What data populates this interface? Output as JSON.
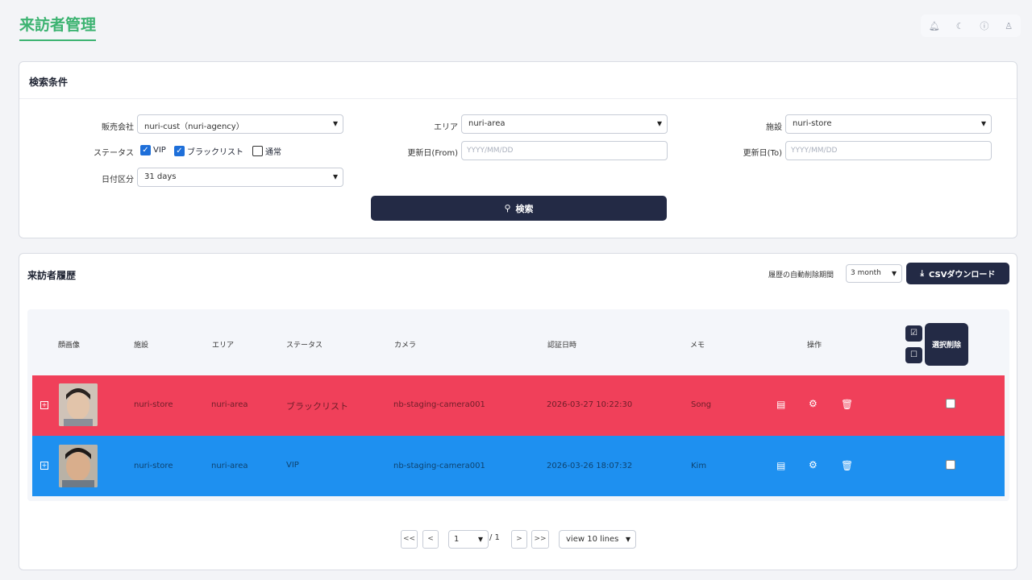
{
  "page": {
    "title": "来訪者管理"
  },
  "top_icons": [
    "bell-icon",
    "moon-icon",
    "help-icon",
    "user-icon"
  ],
  "search": {
    "title": "検索条件",
    "company_label": "販売会社",
    "company_value": "nuri-cust（nuri-agency）",
    "area_label": "エリア",
    "area_value": "nuri-area",
    "store_label": "施設",
    "store_value": "nuri-store",
    "status_label": "ステータス",
    "status_options": [
      {
        "label": "VIP",
        "checked": true
      },
      {
        "label": "ブラックリスト",
        "checked": true
      },
      {
        "label": "通常",
        "checked": false
      }
    ],
    "date_from_label": "更新日(From)",
    "date_from_placeholder": "YYYY/MM/DD",
    "date_to_label": "更新日(To)",
    "date_to_placeholder": "YYYY/MM/DD",
    "period_label": "日付区分",
    "period_value": "31 days",
    "button_label": "検索"
  },
  "history": {
    "title": "来訪者履歴",
    "retention_label": "履歴の自動削除期間",
    "retention_value": "3 month",
    "csv_label": "CSVダウンロード",
    "bulk_delete_label": "選択削除",
    "columns": [
      "顔画像",
      "施設",
      "エリア",
      "ステータス",
      "カメラ",
      "認証日時",
      "メモ",
      "操作"
    ],
    "rows": [
      {
        "store": "nuri-store",
        "area": "nuri-area",
        "status": "ブラックリスト",
        "camera": "nb-staging-camera001",
        "datetime": "2026-03-27 10:22:30",
        "memo": "Song",
        "color": "#f0405a"
      },
      {
        "store": "nuri-store",
        "area": "nuri-area",
        "status": "VIP",
        "camera": "nb-staging-camera001",
        "datetime": "2026-03-26 18:07:32",
        "memo": "Kim",
        "color": "#1e90f0"
      }
    ]
  },
  "pagination": {
    "first": "<<",
    "prev": "<",
    "page": "1",
    "total": "/ 1",
    "next": ">",
    "last": ">>",
    "per_page": "view 10 lines"
  }
}
